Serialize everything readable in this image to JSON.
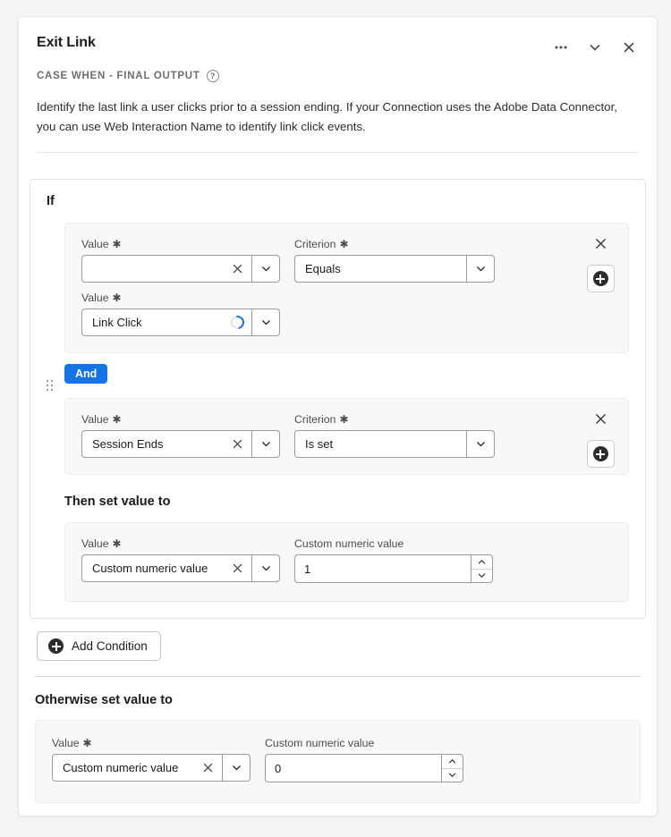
{
  "header": {
    "title": "Exit Link",
    "subtitle": "CASE WHEN - FINAL OUTPUT",
    "help_icon": "help-circle-icon",
    "description": "Identify the last link a user clicks prior to a session ending. If your Connection uses the Adobe Data Connector, you can use Web Interaction Name to identify link click events.",
    "icons": {
      "more": "•••",
      "more_name": "more-options-icon",
      "collapse": "⌵",
      "collapse_name": "chevron-down-icon",
      "close": "✕",
      "close_name": "close-icon"
    }
  },
  "labels": {
    "if": "If",
    "then": "Then set value to",
    "otherwise": "Otherwise set value to",
    "value": "Value",
    "criterion": "Criterion",
    "custom_numeric_value": "Custom numeric value",
    "required_mark": "✱",
    "clear": "✕",
    "chevron_down": "⌵",
    "chevron_up": "∧",
    "chevron_down_small": "∨"
  },
  "operators": {
    "and": "And"
  },
  "buttons": {
    "add_condition": "Add Condition",
    "add_row": "add-row-button",
    "remove_row": "remove-row-button"
  },
  "conditions": [
    {
      "value_primary": "",
      "value_primary_placeholder": "",
      "criterion": "Equals",
      "value_secondary": "Link Click",
      "loading": true
    },
    {
      "value_primary": "Session Ends",
      "criterion": "Is set"
    }
  ],
  "then_block": {
    "value": "Custom numeric value",
    "numeric_label": "Custom numeric value",
    "numeric_value": "1"
  },
  "otherwise_block": {
    "value": "Custom numeric value",
    "numeric_label": "Custom numeric value",
    "numeric_value": "0"
  },
  "colors": {
    "accent": "#1473e6",
    "page_bg": "#f4f4f4",
    "panel_bg": "#f8f8f8",
    "text": "#1b1b1b"
  }
}
